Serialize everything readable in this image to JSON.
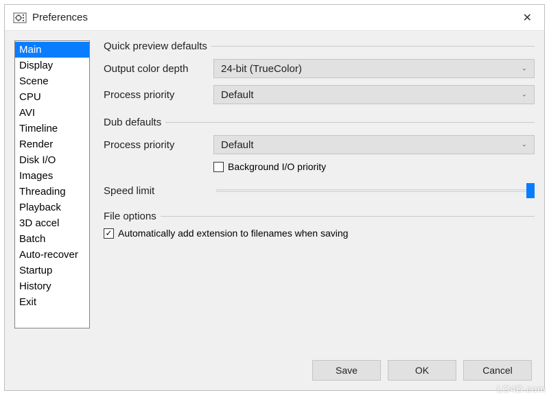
{
  "window": {
    "title": "Preferences"
  },
  "sidebar": {
    "items": [
      {
        "label": "Main",
        "selected": true
      },
      {
        "label": "Display"
      },
      {
        "label": "Scene"
      },
      {
        "label": "CPU"
      },
      {
        "label": "AVI"
      },
      {
        "label": "Timeline"
      },
      {
        "label": "Render"
      },
      {
        "label": "Disk I/O"
      },
      {
        "label": "Images"
      },
      {
        "label": "Threading"
      },
      {
        "label": "Playback"
      },
      {
        "label": "3D accel"
      },
      {
        "label": "Batch"
      },
      {
        "label": "Auto-recover"
      },
      {
        "label": "Startup"
      },
      {
        "label": "History"
      },
      {
        "label": "Exit"
      }
    ]
  },
  "groups": {
    "quick_preview": {
      "legend": "Quick preview defaults",
      "color_depth_label": "Output color depth",
      "color_depth_value": "24-bit (TrueColor)",
      "priority_label": "Process priority",
      "priority_value": "Default"
    },
    "dub": {
      "legend": "Dub defaults",
      "priority_label": "Process priority",
      "priority_value": "Default",
      "bg_io_label": "Background I/O priority",
      "bg_io_checked": false,
      "speed_label": "Speed limit",
      "speed_value": 100
    },
    "file": {
      "legend": "File options",
      "auto_ext_label": "Automatically add extension to filenames when saving",
      "auto_ext_checked": true
    }
  },
  "buttons": {
    "save": "Save",
    "ok": "OK",
    "cancel": "Cancel"
  },
  "watermark": "LO4D.com"
}
